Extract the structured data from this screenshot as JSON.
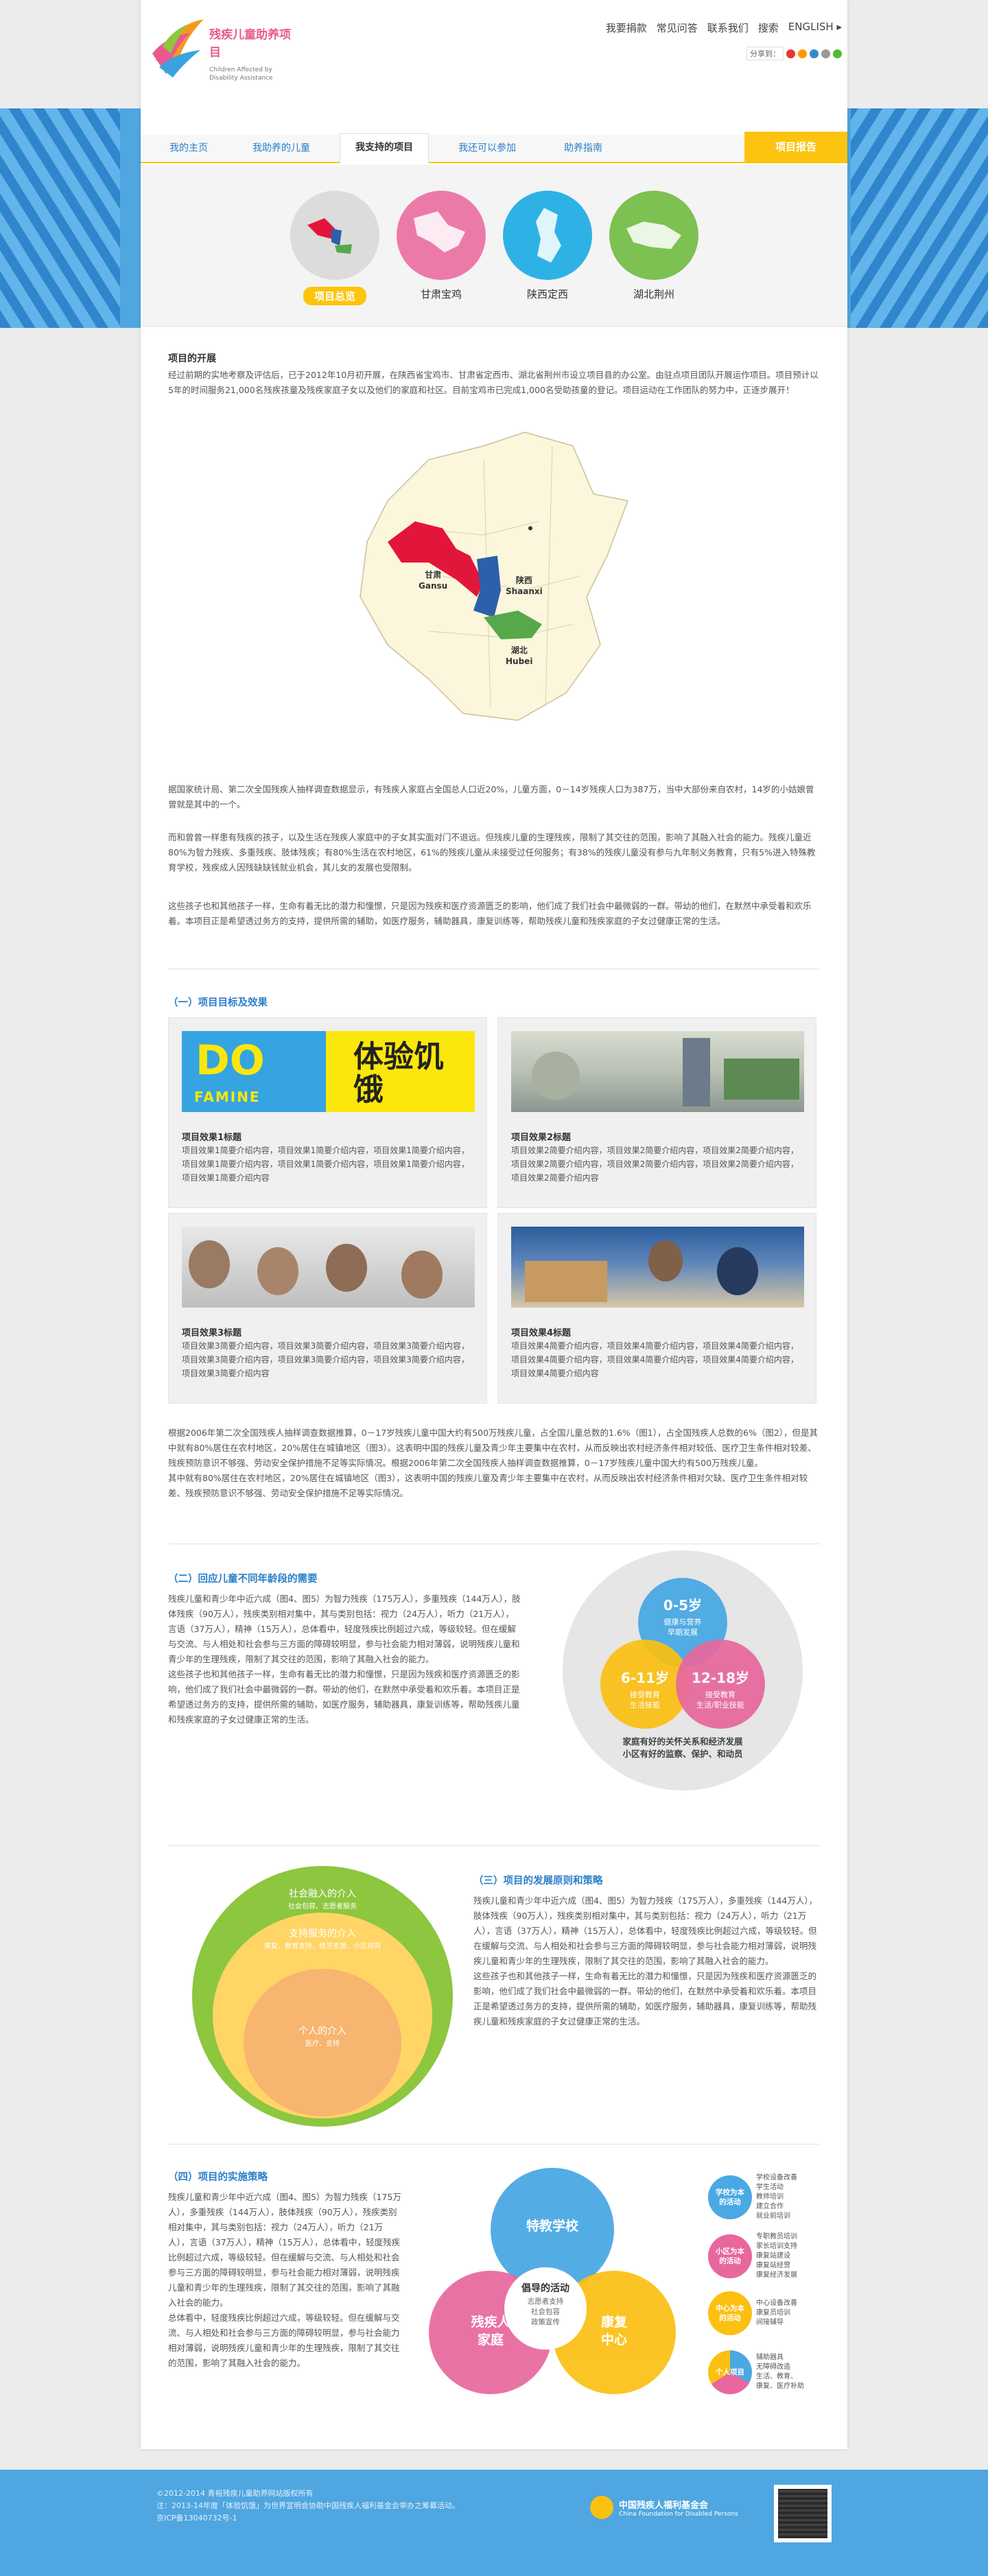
{
  "header": {
    "logo_cn": "残疾儿童助养项目",
    "logo_en": "Children Affected by Disability Assistance",
    "topnav": [
      "我要捐款",
      "常见问答",
      "联系我们",
      "搜索",
      "ENGLISH"
    ],
    "share_label": "分享到："
  },
  "nav": {
    "items": [
      "我的主页",
      "我助养的儿童",
      "我支持的项目",
      "我还可以参加",
      "助养指南"
    ],
    "report": "项目报告"
  },
  "provinces": [
    {
      "label": "项目总览",
      "color": "#dcdcdc"
    },
    {
      "label": "甘肃宝鸡",
      "color": "#ec7aa9"
    },
    {
      "label": "陕西定西",
      "color": "#2eb2e6"
    },
    {
      "label": "湖北荆州",
      "color": "#7cc151"
    }
  ],
  "intro": {
    "title": "项目的开展",
    "text": "经过前期的实地考察及评估后，已于2012年10月初开展，在陕西省宝鸡市、甘肃省定西市、湖北省荆州市设立项目县的办公室。由驻点项目团队开展运作项目。项目预计以5年的时间服务21,000名残疾孩童及残疾家庭子女以及他们的家庭和社区。目前宝鸡市已完成1,000名受助孩童的登记。项目运动在工作团队的努力中，正逐步展开！"
  },
  "map": {
    "gansu": "甘肃",
    "gansu_en": "Gansu",
    "shaanxi": "陕西",
    "shaanxi_en": "Shaanxi",
    "hubei": "湖北",
    "hubei_en": "Hubei"
  },
  "paras": [
    "据国家统计局、第二次全国残疾人抽样调查数据显示，有残疾人家庭占全国总人口近20%，儿童方面，0－14岁残疾人口为387万，当中大部份来自农村，14岁的小姑娘曾曾就是其中的一个。",
    "而和曾曾一样患有残疾的孩子，以及生活在残疾人家庭中的子女其实面对门不退远。但残疾儿童的生理残疾，限制了其交往的范围，影响了其融入社会的能力。残疾儿童近80%为智力残疾、多重残疾、肢体残疾；有80%生活在农村地区，61%的残疾儿童从未接受过任何服务；有38%的残疾儿童没有参与九年制义务教育，只有5%进入特殊教育学校，残疾成人因残缺缺钱就业机会，其儿女的发展也受限制。",
    "这些孩子也和其他孩子一样，生命有着无比的潜力和憧憬，只是因为残疾和医疗资源匮乏的影响，他们成了我们社会中最微弱的一群。带幼的他们，在默然中承受着和欢乐着。本项目正是希望透过务方的支持，提供所需的辅助，如医疗服务，辅助器具，康复训练等，帮助残疾儿童和残疾家庭的子女过健康正常的生活。"
  ],
  "sec1": {
    "title": "（一）项目目标及效果",
    "cards": [
      {
        "title": "项目效果1标题",
        "desc": "项目效果1简要介绍内容，项目效果1简要介绍内容，项目效果1简要介绍内容，项目效果1简要介绍内容，项目效果1简要介绍内容，项目效果1简要介绍内容，项目效果1简要介绍内容",
        "img": "famine"
      },
      {
        "title": "项目效果2标题",
        "desc": "项目效果2简要介绍内容，项目效果2简要介绍内容，项目效果2简要介绍内容，项目效果2简要介绍内容，项目效果2简要介绍内容，项目效果2简要介绍内容，项目效果2简要介绍内容",
        "img": "photo"
      },
      {
        "title": "项目效果3标题",
        "desc": "项目效果3简要介绍内容，项目效果3简要介绍内容，项目效果3简要介绍内容，项目效果3简要介绍内容，项目效果3简要介绍内容，项目效果3简要介绍内容，项目效果3简要介绍内容",
        "img": "photo"
      },
      {
        "title": "项目效果4标题",
        "desc": "项目效果4简要介绍内容，项目效果4简要介绍内容，项目效果4简要介绍内容，项目效果4简要介绍内容，项目效果4简要介绍内容，项目效果4简要介绍内容，项目效果4简要介绍内容",
        "img": "photo"
      }
    ],
    "famine_en": "FAMINE",
    "famine_cn": "体验饥饿"
  },
  "stat": "根据2006年第二次全国残疾人抽样调查数据推算，0－17岁残疾儿童中国大约有500万残疾儿童，占全国儿童总数的1.6%（图1），占全国残疾人总数的6%（图2），但是其中就有80%居住在农村地区，20%居住在城镇地区（图3）。这表明中国的残疾儿童及青少年主要集中在农村，从而反映出农村经济条件相对较低、医疗卫生条件相对较差、残疾预防意识不够强、劳动安全保护措施不足等实际情况。根据2006年第二次全国残疾人抽样调查数据推算，0－17岁残疾儿童中国大约有500万残疾儿童。\n其中就有80%居住在农村地区，20%居住在城镇地区（图3），这表明中国的残疾儿童及青少年主要集中在农村，从而反映出农村经济条件相对欠缺、医疗卫生条件相对较差、残疾预防意识不够强、劳动安全保护措施不足等实际情况。",
  "sec2": {
    "title": "（二）回应儿童不同年龄段的需要",
    "text": "残疾儿童和青少年中近六成（图4、图5）为智力残疾（175万人），多重残疾（144万人），肢体残疾（90万人），残疾类别相对集中，其与类别包括：视力（24万人），听力（21万人），言语（37万人），精神（15万人），总体看中，轻度残疾比例超过六成，等级较轻。但在缓解与交流、与人相处和社会参与三方面的障碍较明显，参与社会能力相对薄弱，说明残疾儿童和青少年的生理残疾，限制了其交往的范围，影响了其融入社会的能力。\n这些孩子也和其他孩子一样，生命有着无比的潜力和憧憬，只是因为残疾和医疗资源匮乏的影响，他们成了我们社会中最微弱的一群。带幼的他们，在默然中承受着和欢乐着。本项目正是希望透过务方的支持，提供所需的辅助，如医疗服务，辅助器具，康复训练等，帮助残疾儿童和残疾家庭的子女过健康正常的生活。",
    "c1": "0-5岁",
    "c1s": "健康与营养\n早期发展",
    "c2": "6-11岁",
    "c2s": "接受教育\n生活技能",
    "c3": "12-18岁",
    "c3s": "接受教育\n生活/职业技能",
    "cap": "家庭有好的关怀关系和经济发展\n小区有好的监察、保护、和动员"
  },
  "sec3": {
    "title": "（三）项目的发展原则和策略",
    "text": "残疾儿童和青少年中近六成（图4、图5）为智力残疾（175万人），多重残疾（144万人），肢体残疾（90万人），残疾类别相对集中，其与类别包括：视力（24万人），听力（21万人），言语（37万人），精神（15万人），总体看中，轻度残疾比例超过六成，等级较轻。但在缓解与交流、与人相处和社会参与三方面的障碍较明显，参与社会能力相对薄弱，说明残疾儿童和青少年的生理残疾，限制了其交往的范围，影响了其融入社会的能力。\n这些孩子也和其他孩子一样，生命有着无比的潜力和憧憬，只是因为残疾和医疗资源匮乏的影响，他们成了我们社会中最微弱的一群。带幼的他们，在默然中承受着和欢乐着。本项目正是希望透过务方的支持，提供所需的辅助，如医疗服务，辅助器具，康复训练等，帮助残疾儿童和残疾家庭的子女过健康正常的生活。",
    "r1": "社会融入的介入",
    "r1s": "社会包容、志愿者服务",
    "r2": "支持服务的介入",
    "r2s": "康复、教育支持、经济支援、小区共同",
    "r3": "个人的介入",
    "r3s": "医疗、支持"
  },
  "sec4": {
    "title": "（四）项目的实施策略",
    "text": "残疾儿童和青少年中近六成（图4、图5）为智力残疾（175万人），多重残疾（144万人），肢体残疾（90万人），残疾类别相对集中，其与类别包括：视力（24万人），听力（21万人），言语（37万人），精神（15万人），总体看中，轻度残疾比例超过六成，等级较轻。但在缓解与交流、与人相处和社会参与三方面的障碍较明显，参与社会能力相对薄弱，说明残疾儿童和青少年的生理残疾，限制了其交往的范围，影响了其融入社会的能力。\n总体看中，轻度残疾比例超过六成，等级较轻。但在缓解与交流、与人相处和社会参与三方面的障碍较明显，参与社会能力相对薄弱，说明残疾儿童和青少年的生理残疾，限制了其交往的范围，影响了其融入社会的能力。",
    "v1": "特教学校",
    "v2": "残疾人\n家庭",
    "v3": "康复\n中心",
    "center": "倡导的活动",
    "center_s": "志愿者支持\n社会包容\n政策宣传",
    "legend": [
      {
        "b": "学校为本\n的活动",
        "t": "学校设备改善\n学生活动\n教师培训\n建立合作\n就业前培训",
        "c": "#4aa9e3"
      },
      {
        "b": "小区为本\n的活动",
        "t": "专职教员培训\n家长培训支持\n康复站建设\n康复站经营\n康复经济发展",
        "c": "#e8679e"
      },
      {
        "b": "中心为本\n的活动",
        "t": "中心设备改善\n康复员培训\n间接辅导",
        "c": "#fbc012"
      },
      {
        "b": "个人项目",
        "t": "辅助器具\n无障碍改造\n生活、教育、\n康复、医疗补助",
        "c": "#4aa9e3"
      }
    ]
  },
  "footer": {
    "lines": [
      "©2012-2014 青裕残疾儿童助养网站版权所有",
      "注：2013-14年度「体验饥饿」为世界宣明会协助中国残疾人福利基金会举办之筹募活动。",
      "京ICP备13040732号-1"
    ],
    "org_cn": "中国残疾人福利基金会",
    "org_en": "China Foundation for Disabled Persons"
  }
}
